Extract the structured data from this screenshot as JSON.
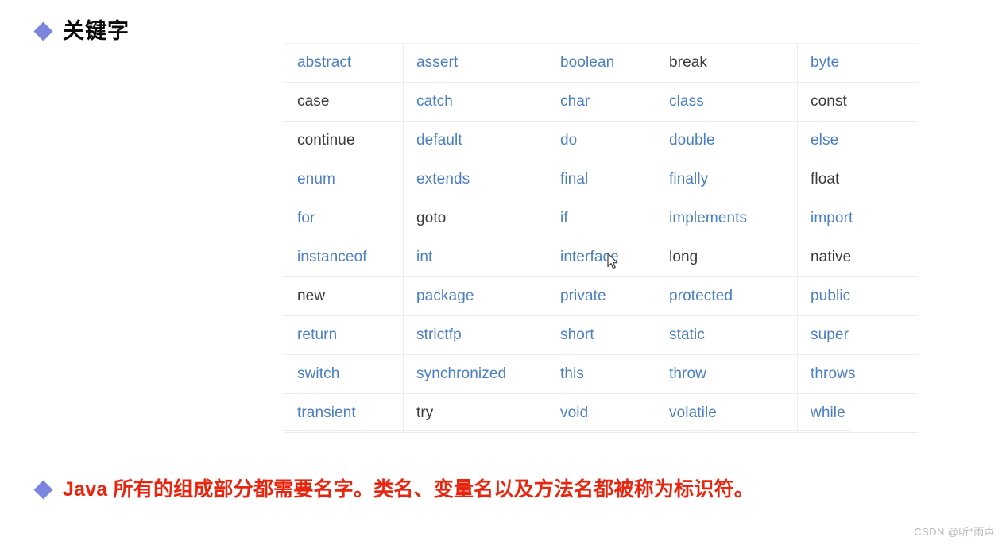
{
  "heading": {
    "bullet_color": "#7b85dd",
    "title": "关键字"
  },
  "keyword_table": {
    "link_color": "#4b7fc2",
    "plain_color": "#3b3b3b",
    "columns": 5,
    "rows": [
      [
        {
          "text": "abstract",
          "style": "link"
        },
        {
          "text": "assert",
          "style": "link"
        },
        {
          "text": "boolean",
          "style": "link"
        },
        {
          "text": "break",
          "style": "plain"
        },
        {
          "text": "byte",
          "style": "link"
        }
      ],
      [
        {
          "text": "case",
          "style": "plain"
        },
        {
          "text": "catch",
          "style": "link"
        },
        {
          "text": "char",
          "style": "link"
        },
        {
          "text": "class",
          "style": "link"
        },
        {
          "text": "const",
          "style": "plain"
        }
      ],
      [
        {
          "text": "continue",
          "style": "plain"
        },
        {
          "text": "default",
          "style": "link"
        },
        {
          "text": "do",
          "style": "link"
        },
        {
          "text": "double",
          "style": "link"
        },
        {
          "text": "else",
          "style": "link"
        }
      ],
      [
        {
          "text": "enum",
          "style": "link"
        },
        {
          "text": "extends",
          "style": "link"
        },
        {
          "text": "final",
          "style": "link"
        },
        {
          "text": "finally",
          "style": "link"
        },
        {
          "text": "float",
          "style": "plain"
        }
      ],
      [
        {
          "text": "for",
          "style": "link"
        },
        {
          "text": "goto",
          "style": "plain"
        },
        {
          "text": "if",
          "style": "link"
        },
        {
          "text": "implements",
          "style": "link"
        },
        {
          "text": "import",
          "style": "link"
        }
      ],
      [
        {
          "text": "instanceof",
          "style": "link"
        },
        {
          "text": "int",
          "style": "link"
        },
        {
          "text": "interface",
          "style": "link"
        },
        {
          "text": "long",
          "style": "plain"
        },
        {
          "text": "native",
          "style": "plain"
        }
      ],
      [
        {
          "text": "new",
          "style": "plain"
        },
        {
          "text": "package",
          "style": "link"
        },
        {
          "text": "private",
          "style": "link"
        },
        {
          "text": "protected",
          "style": "link"
        },
        {
          "text": "public",
          "style": "link"
        }
      ],
      [
        {
          "text": "return",
          "style": "link"
        },
        {
          "text": "strictfp",
          "style": "link"
        },
        {
          "text": "short",
          "style": "link"
        },
        {
          "text": "static",
          "style": "link"
        },
        {
          "text": "super",
          "style": "link"
        }
      ],
      [
        {
          "text": "switch",
          "style": "link"
        },
        {
          "text": "synchronized",
          "style": "link"
        },
        {
          "text": "this",
          "style": "link"
        },
        {
          "text": "throw",
          "style": "link"
        },
        {
          "text": "throws",
          "style": "link"
        }
      ],
      [
        {
          "text": "transient",
          "style": "link"
        },
        {
          "text": "try",
          "style": "plain"
        },
        {
          "text": "void",
          "style": "link"
        },
        {
          "text": "volatile",
          "style": "link"
        },
        {
          "text": "while",
          "style": "link"
        }
      ]
    ]
  },
  "bottom_note": {
    "bullet_color": "#7b85dd",
    "text_color": "#e8260f",
    "text": "Java 所有的组成部分都需要名字。类名、变量名以及方法名都被称为标识符。"
  },
  "watermark": {
    "text": "CSDN @听*雨声"
  }
}
